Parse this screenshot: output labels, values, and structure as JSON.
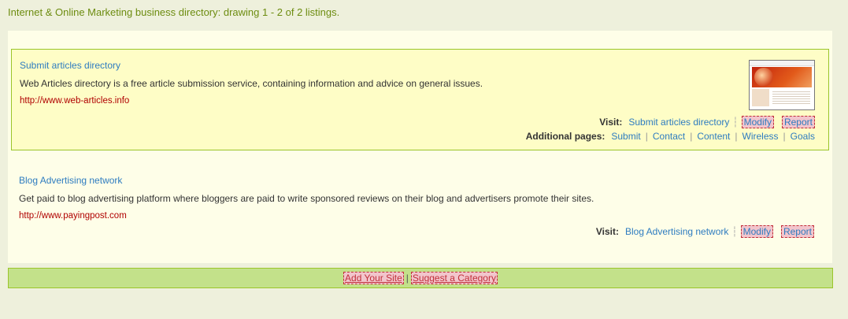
{
  "directory": {
    "heading": "Internet & Online Marketing business directory: drawing 1 - 2 of 2 listings."
  },
  "listings": [
    {
      "title": "Submit articles directory",
      "description": "Web Articles directory is a free article submission service, containing information and advice on general issues.",
      "url": "http://www.web-articles.info",
      "visit_label": "Visit:",
      "visit_link": "Submit articles directory",
      "modify": "Modify",
      "report": "Report",
      "additional_label": "Additional pages:",
      "pages": [
        "Submit",
        "Contact",
        "Content",
        "Wireless",
        "Goals"
      ]
    },
    {
      "title": "Blog Advertising network",
      "description": "Get paid to blog advertising platform where bloggers are paid to write sponsored reviews on their blog and advertisers promote their sites.",
      "url": "http://www.payingpost.com",
      "visit_label": "Visit:",
      "visit_link": "Blog Advertising network",
      "modify": "Modify",
      "report": "Report"
    }
  ],
  "footer": {
    "add_site": "Add Your Site",
    "separator": "|",
    "suggest": "Suggest a Category"
  }
}
